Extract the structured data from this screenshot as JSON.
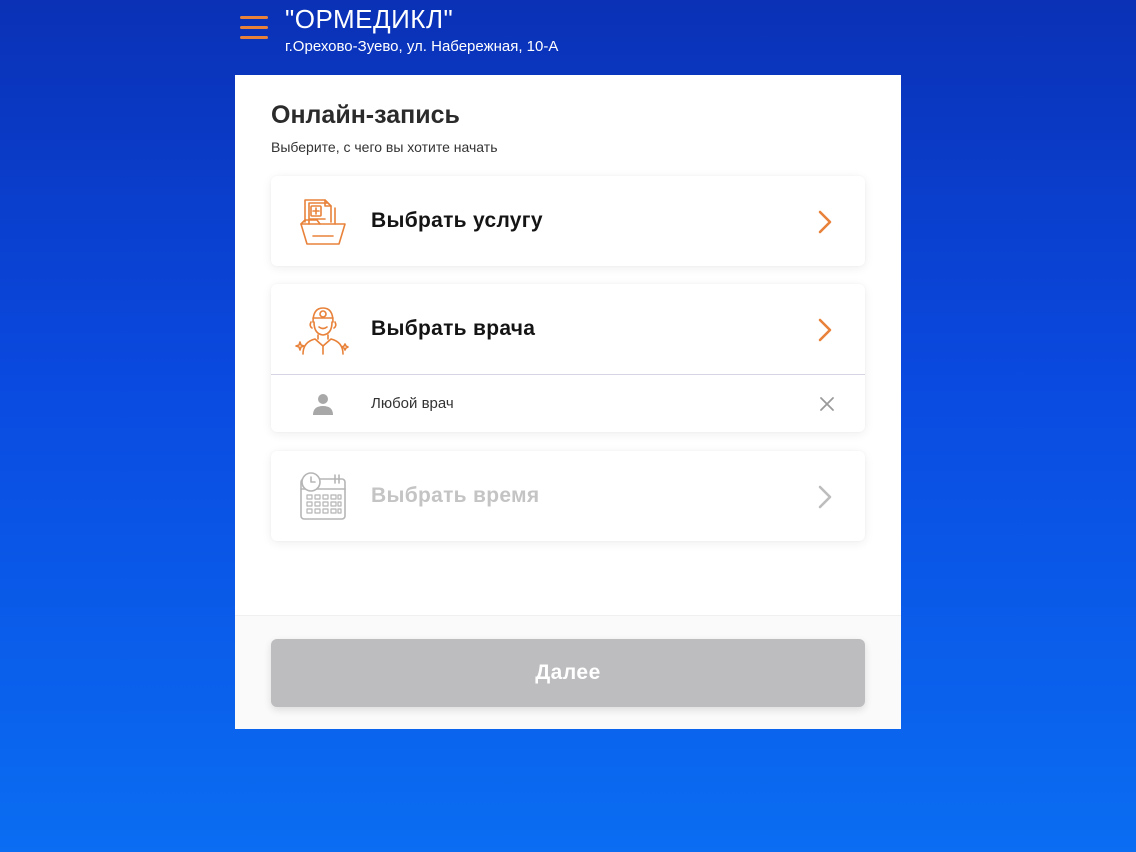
{
  "header": {
    "clinic_name": "\"ОРМЕДИКЛ\"",
    "address": "г.Орехово-Зуево, ул. Набережная, 10-А",
    "menu_icon": "hamburger-menu-icon"
  },
  "main": {
    "title": "Онлайн-запись",
    "subtitle": "Выберите, с чего вы хотите начать",
    "options": [
      {
        "label": "Выбрать услугу",
        "icon": "medical-folder-icon",
        "enabled": true
      },
      {
        "label": "Выбрать врача",
        "icon": "doctor-icon",
        "enabled": true,
        "selected_value": "Любой врач"
      },
      {
        "label": "Выбрать время",
        "icon": "calendar-clock-icon",
        "enabled": false
      }
    ]
  },
  "footer": {
    "next_label": "Далее",
    "next_enabled": false
  },
  "colors": {
    "accent": "#e8823a",
    "background_top": "#0a31b6",
    "background_bottom": "#0a6df2",
    "disabled_button": "#bdbcbf",
    "disabled_text": "#c4c4c4"
  }
}
